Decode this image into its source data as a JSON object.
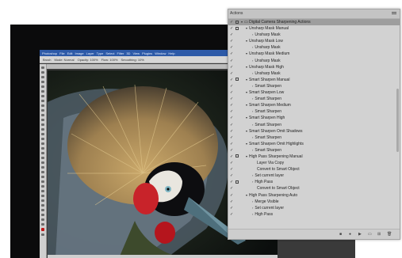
{
  "photoshop": {
    "menu": [
      "Photoshop",
      "File",
      "Edit",
      "Image",
      "Layer",
      "Type",
      "Select",
      "Filter",
      "3D",
      "View",
      "Plugins",
      "Window",
      "Help"
    ],
    "options": [
      "Brush",
      "Mode: Normal",
      "Opacity: 100%",
      "Flow: 100%",
      "Smoothing: 10%"
    ]
  },
  "actions_panel": {
    "tab_label": "Actions",
    "rows": [
      {
        "label": "Digital Camera Sharpening Actions",
        "indent": 16,
        "check": true,
        "toggle": true,
        "arrow": "▾",
        "selected": true,
        "folder": true
      },
      {
        "label": "Unsharp Mask Manual",
        "indent": 22,
        "check": true,
        "toggle": true,
        "arrow": "▾"
      },
      {
        "label": "Unsharp Mask",
        "indent": 30,
        "check": true,
        "toggle": false,
        "arrow": "›"
      },
      {
        "label": "Unsharp Mask Low",
        "indent": 22,
        "check": true,
        "toggle": false,
        "arrow": "▾"
      },
      {
        "label": "Unsharp Mask",
        "indent": 30,
        "check": true,
        "toggle": false,
        "arrow": "›"
      },
      {
        "label": "Unsharp Mask Medium",
        "indent": 22,
        "check": true,
        "toggle": false,
        "arrow": "▾"
      },
      {
        "label": "Unsharp Mask",
        "indent": 30,
        "check": true,
        "toggle": false,
        "arrow": "›"
      },
      {
        "label": "Unsharp Mask High",
        "indent": 22,
        "check": true,
        "toggle": false,
        "arrow": "▾"
      },
      {
        "label": "Unsharp Mask",
        "indent": 30,
        "check": true,
        "toggle": false,
        "arrow": "›"
      },
      {
        "label": "Smart Sharpen Manual",
        "indent": 22,
        "check": true,
        "toggle": true,
        "arrow": "▾"
      },
      {
        "label": "Smart Sharpen",
        "indent": 30,
        "check": true,
        "toggle": false,
        "arrow": "›"
      },
      {
        "label": "Smart Sharpen Low",
        "indent": 22,
        "check": true,
        "toggle": false,
        "arrow": "▾"
      },
      {
        "label": "Smart Sharpen",
        "indent": 30,
        "check": true,
        "toggle": false,
        "arrow": "›"
      },
      {
        "label": "Smart Sharpen Medium",
        "indent": 22,
        "check": true,
        "toggle": false,
        "arrow": "▾"
      },
      {
        "label": "Smart Sharpen",
        "indent": 30,
        "check": true,
        "toggle": false,
        "arrow": "›"
      },
      {
        "label": "Smart Sharpen High",
        "indent": 22,
        "check": true,
        "toggle": false,
        "arrow": "▾"
      },
      {
        "label": "Smart Sharpen",
        "indent": 30,
        "check": true,
        "toggle": false,
        "arrow": "›"
      },
      {
        "label": "Smart Sharpen Omit Shadows",
        "indent": 22,
        "check": true,
        "toggle": false,
        "arrow": "▾"
      },
      {
        "label": "Smart Sharpen",
        "indent": 30,
        "check": true,
        "toggle": false,
        "arrow": "›"
      },
      {
        "label": "Smart Sharpen Omit Highlights",
        "indent": 22,
        "check": true,
        "toggle": false,
        "arrow": "▾"
      },
      {
        "label": "Smart Sharpen",
        "indent": 30,
        "check": true,
        "toggle": false,
        "arrow": "›"
      },
      {
        "label": "High Pass Sharpening Manual",
        "indent": 22,
        "check": true,
        "toggle": true,
        "arrow": "▾"
      },
      {
        "label": "Layer Via Copy",
        "indent": 36,
        "check": true,
        "toggle": false,
        "arrow": ""
      },
      {
        "label": "Convert to Smart Object",
        "indent": 36,
        "check": true,
        "toggle": false,
        "arrow": ""
      },
      {
        "label": "Set current layer",
        "indent": 30,
        "check": true,
        "toggle": false,
        "arrow": "›"
      },
      {
        "label": "High Pass",
        "indent": 30,
        "check": true,
        "toggle": true,
        "arrow": "›"
      },
      {
        "label": "Convert to Smart Object",
        "indent": 36,
        "check": true,
        "toggle": false,
        "arrow": ""
      },
      {
        "label": "High Pass Sharpening Auto",
        "indent": 22,
        "check": true,
        "toggle": false,
        "arrow": "▾"
      },
      {
        "label": "Merge Visible",
        "indent": 30,
        "check": true,
        "toggle": false,
        "arrow": "›"
      },
      {
        "label": "Set current layer",
        "indent": 30,
        "check": true,
        "toggle": false,
        "arrow": "›"
      },
      {
        "label": "High Pass",
        "indent": 30,
        "check": true,
        "toggle": false,
        "arrow": "›"
      }
    ],
    "footer_icons": [
      "stop-icon",
      "record-icon",
      "play-icon",
      "new-set-icon",
      "new-action-icon",
      "trash-icon"
    ]
  }
}
